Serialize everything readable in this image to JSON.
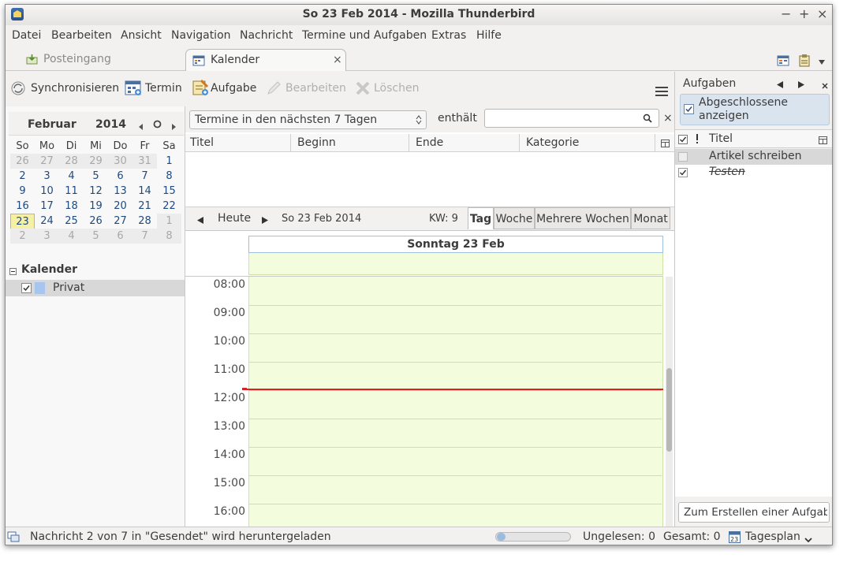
{
  "window": {
    "title": "So 23 Feb 2014 - Mozilla Thunderbird",
    "controls": [
      "−",
      "+",
      "×"
    ]
  },
  "menubar": [
    "Datei",
    "Bearbeiten",
    "Ansicht",
    "Navigation",
    "Nachricht",
    "Termine und Aufgaben",
    "Extras",
    "Hilfe"
  ],
  "tabs": {
    "inbox": "Posteingang",
    "calendar": "Kalender",
    "close": "×"
  },
  "toolbar": {
    "sync": "Synchronisieren",
    "event": "Termin",
    "task": "Aufgabe",
    "edit": "Bearbeiten",
    "delete": "Löschen"
  },
  "filter": {
    "range": "Termine in den nächsten 7 Tagen",
    "contains_label": "enthält",
    "search_value": "",
    "close": "×"
  },
  "list_columns": [
    "Titel",
    "Beginn",
    "Ende",
    "Kategorie"
  ],
  "minical": {
    "month": "Februar",
    "year": "2014",
    "weekdays": [
      "So",
      "Mo",
      "Di",
      "Mi",
      "Do",
      "Fr",
      "Sa"
    ],
    "weeks": [
      [
        "26",
        "27",
        "28",
        "29",
        "30",
        "31",
        "1"
      ],
      [
        "2",
        "3",
        "4",
        "5",
        "6",
        "7",
        "8"
      ],
      [
        "9",
        "10",
        "11",
        "12",
        "13",
        "14",
        "15"
      ],
      [
        "16",
        "17",
        "18",
        "19",
        "20",
        "21",
        "22"
      ],
      [
        "23",
        "24",
        "25",
        "26",
        "27",
        "28",
        "1"
      ],
      [
        "2",
        "3",
        "4",
        "5",
        "6",
        "7",
        "8"
      ]
    ],
    "today": "23"
  },
  "calendars": {
    "header": "Kalender",
    "items": [
      {
        "name": "Privat",
        "checked": true,
        "color": "#a8c5ee"
      }
    ]
  },
  "nav": {
    "today": "Heute",
    "date": "So 23 Feb 2014",
    "week": "KW: 9"
  },
  "views": [
    "Tag",
    "Woche",
    "Mehrere Wochen",
    "Monat"
  ],
  "day": {
    "header": "Sonntag 23 Feb",
    "hours": [
      "08:00",
      "09:00",
      "10:00",
      "11:00",
      "12:00",
      "13:00",
      "14:00",
      "15:00",
      "16:00"
    ]
  },
  "tasks": {
    "title": "Aufgaben",
    "show_completed": "Abgeschlossene anzeigen",
    "column": "Titel",
    "items": [
      {
        "title": "Artikel schreiben",
        "done": false
      },
      {
        "title": "Testen",
        "done": true
      }
    ],
    "new_placeholder": "Zum Erstellen einer Aufgab"
  },
  "status": {
    "message": "Nachricht 2 von 7 in \"Gesendet\" wird heruntergeladen",
    "unread": "Ungelesen: 0",
    "total": "Gesamt: 0",
    "mode": "Tagesplan"
  },
  "colors": {
    "today_highlight": "#f5f0a6",
    "day_background": "#f3fcdd",
    "now_line": "#e02020",
    "selected_row": "#d8d8d8"
  }
}
